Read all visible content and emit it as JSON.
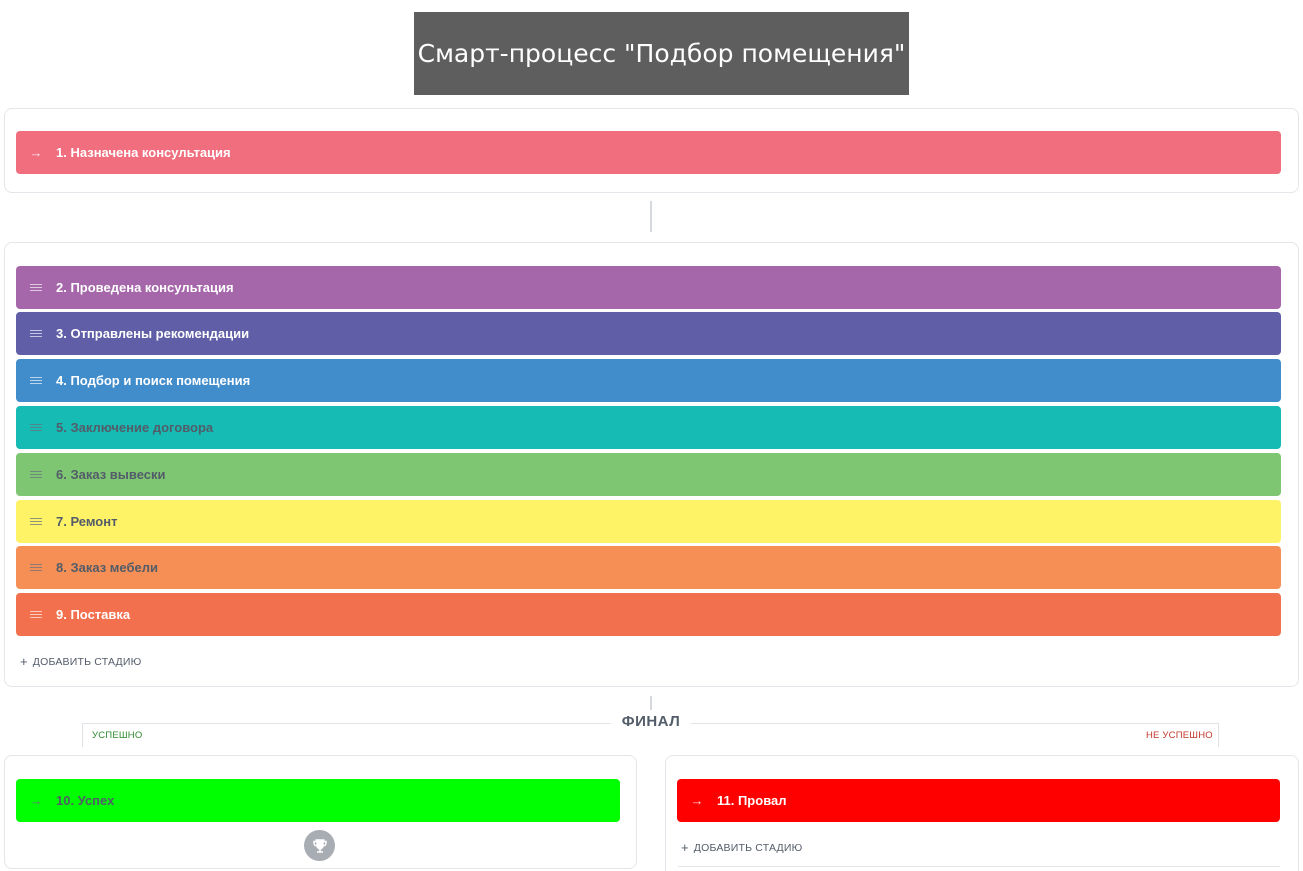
{
  "title": "Смарт-процесс \"Подбор помещения\"",
  "first_stage": {
    "label": "1. Назначена консультация",
    "color": "#f06e7e",
    "icon": "arrow-right-icon"
  },
  "stages": [
    {
      "label": "2. Проведена консультация",
      "color": "#a566aa",
      "text": "light"
    },
    {
      "label": "3. Отправлены рекомендации",
      "color": "#5f5ea6",
      "text": "light"
    },
    {
      "label": "4. Подбор и поиск помещения",
      "color": "#418ccb",
      "text": "light"
    },
    {
      "label": "5. Заключение договора",
      "color": "#16bbb4",
      "text": "dark"
    },
    {
      "label": "6. Заказ вывески",
      "color": "#7fc672",
      "text": "dark"
    },
    {
      "label": "7. Ремонт",
      "color": "#fef266",
      "text": "dark"
    },
    {
      "label": "8. Заказ мебели",
      "color": "#f58f55",
      "text": "dark"
    },
    {
      "label": "9. Поставка",
      "color": "#f2704d",
      "text": "light"
    }
  ],
  "add_stage_label": "ДОБАВИТЬ СТАДИЮ",
  "final": {
    "label": "ФИНАЛ",
    "success_tag": "УСПЕШНО",
    "fail_tag": "НЕ УСПЕШНО",
    "success_stage": {
      "label": "10. Успех",
      "color": "#00ff00",
      "icon": "arrow-right-icon"
    },
    "fail_stage": {
      "label": "11. Провал",
      "color": "#ff0000",
      "icon": "arrow-right-icon"
    },
    "trophy_icon": "trophy-icon"
  }
}
